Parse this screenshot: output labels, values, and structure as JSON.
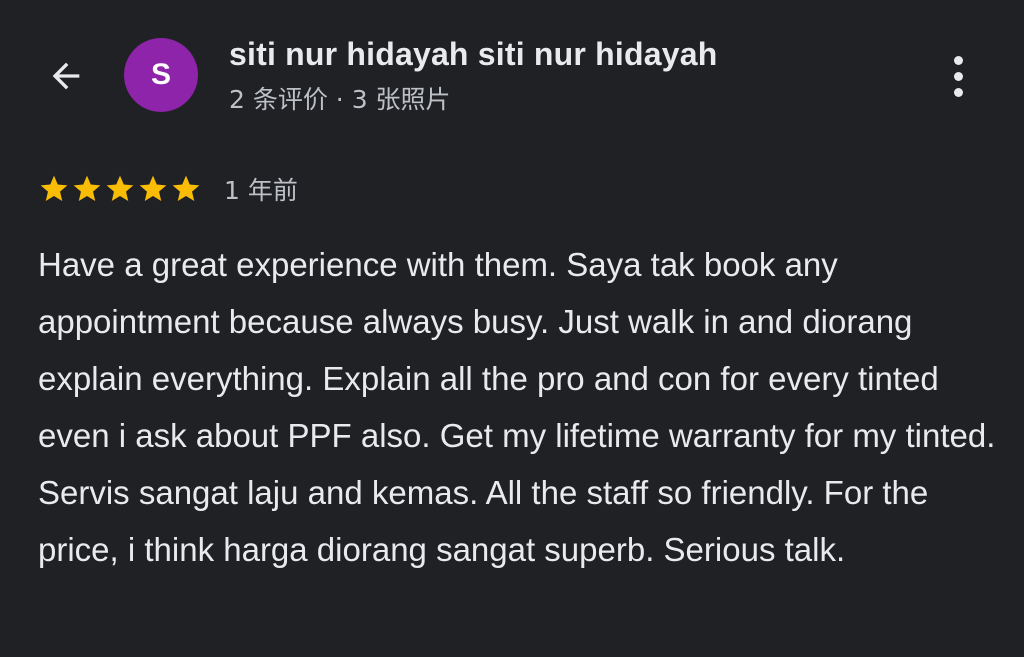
{
  "colors": {
    "background": "#202124",
    "text_primary": "#e8eaed",
    "text_secondary": "#bdc1c6",
    "avatar_bg": "#8e24aa",
    "star": "#fbbc04"
  },
  "header": {
    "back_icon": "arrow-back-icon",
    "avatar_initial": "S",
    "name": "siti nur hidayah siti nur hidayah",
    "meta": "2 条评价 · 3 张照片",
    "more_icon": "more-vert-icon"
  },
  "review": {
    "rating": 5,
    "rating_max": 5,
    "date": "1 年前",
    "text": "Have a great experience with them. Saya tak book any appointment because always busy. Just walk in and diorang explain everything. Explain all the pro and con for every tinted even i ask about PPF also. Get my lifetime warranty for my tinted. Servis sangat laju and kemas. All the staff so friendly. For the price, i think harga diorang sangat superb. Serious talk."
  }
}
